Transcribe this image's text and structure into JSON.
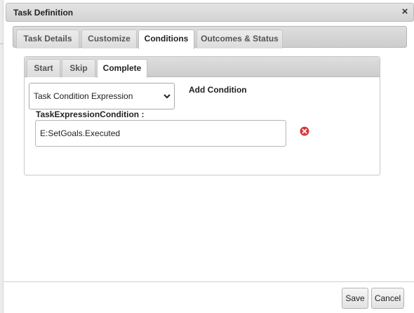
{
  "dialog": {
    "title": "Task Definition",
    "close_label": "×"
  },
  "outer_tabs": [
    {
      "label": "Task Details"
    },
    {
      "label": "Customize"
    },
    {
      "label": "Conditions"
    },
    {
      "label": "Outcomes & Status"
    }
  ],
  "outer_active_tab": "Conditions",
  "inner_tabs": [
    {
      "label": "Start"
    },
    {
      "label": "Skip"
    },
    {
      "label": "Complete"
    }
  ],
  "inner_active_tab": "Complete",
  "condition_type": {
    "selected": "Task Condition Expression"
  },
  "add_condition_label": "Add Condition",
  "expression_field": {
    "label": "TaskExpressionCondition :",
    "value": "E:SetGoals.Executed"
  },
  "footer": {
    "save_label": "Save",
    "cancel_label": "Cancel"
  },
  "colors": {
    "remove_icon": "#d9383a"
  },
  "icons": {
    "close": "close-icon",
    "select": "chevron-down-icon",
    "remove": "remove-circle-icon"
  }
}
